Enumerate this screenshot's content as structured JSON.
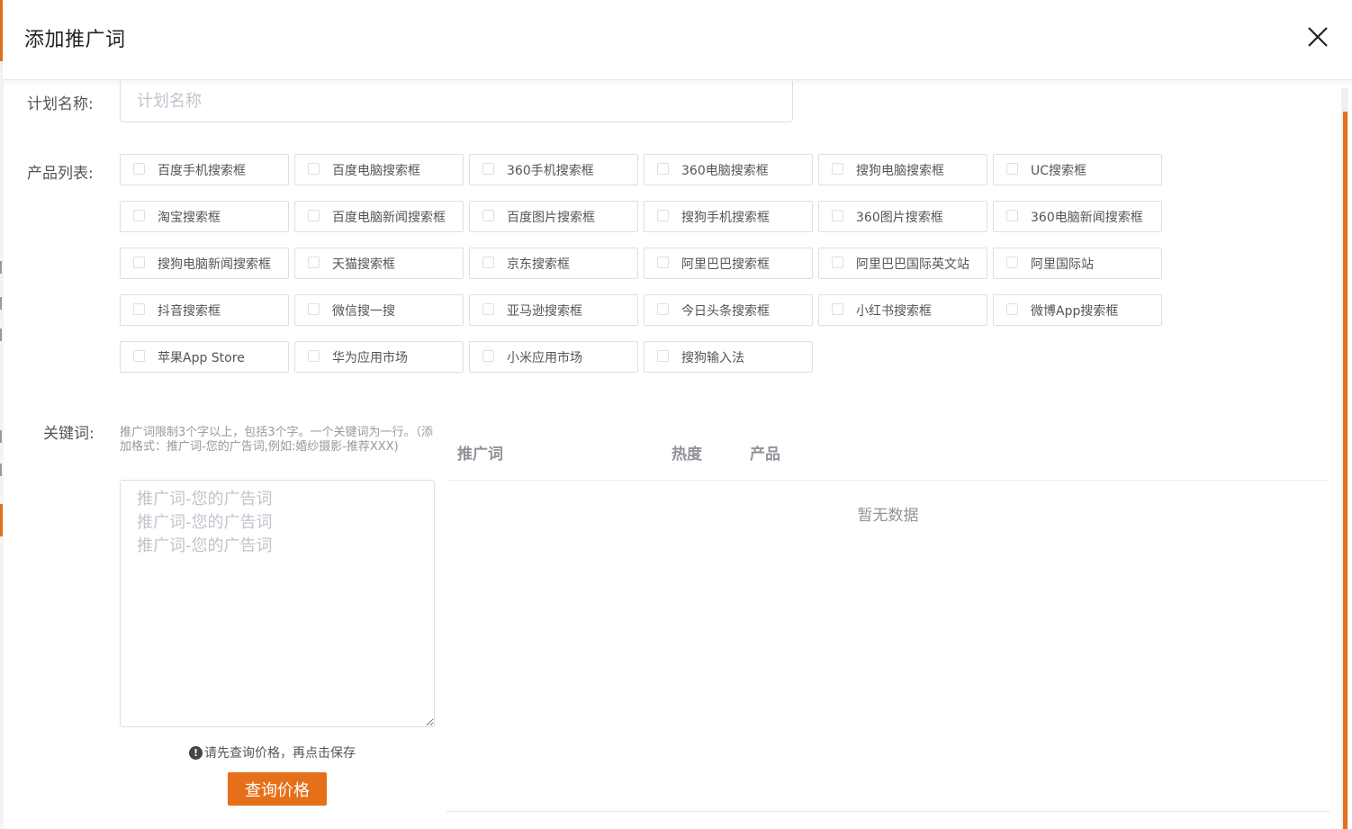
{
  "dialog": {
    "title": "添加推广词"
  },
  "form": {
    "plan_label": "计划名称:",
    "plan_placeholder": "计划名称",
    "products_label": "产品列表:",
    "keywords_label": "关键词:",
    "keywords_hint": "推广词限制3个字以上，包括3个字。一个关键词为一行。（添加格式：推广词-您的广告词,例如:婚纱摄影-推荐XXX)",
    "keywords_placeholder": "推广词-您的广告词\n推广词-您的广告词\n推广词-您的广告词",
    "warning": "请先查询价格，再点击保存",
    "query_button": "查询价格"
  },
  "products": [
    "百度手机搜索框",
    "百度电脑搜索框",
    "360手机搜索框",
    "360电脑搜索框",
    "搜狗电脑搜索框",
    "UC搜索框",
    "淘宝搜索框",
    "百度电脑新闻搜索框",
    "百度图片搜索框",
    "搜狗手机搜索框",
    "360图片搜索框",
    "360电脑新闻搜索框",
    "搜狗电脑新闻搜索框",
    "天猫搜索框",
    "京东搜索框",
    "阿里巴巴搜索框",
    "阿里巴巴国际英文站",
    "阿里国际站",
    "抖音搜索框",
    "微信搜一搜",
    "亚马逊搜索框",
    "今日头条搜索框",
    "小红书搜索框",
    "微博App搜索框",
    "苹果App Store",
    "华为应用市场",
    "小米应用市场",
    "搜狗输入法"
  ],
  "table": {
    "columns": [
      "推广词",
      "热度",
      "产品"
    ],
    "empty_text": "暂无数据"
  },
  "colors": {
    "accent": "#e6701a",
    "border": "#dcdfe6",
    "placeholder": "#c0c4cc"
  }
}
